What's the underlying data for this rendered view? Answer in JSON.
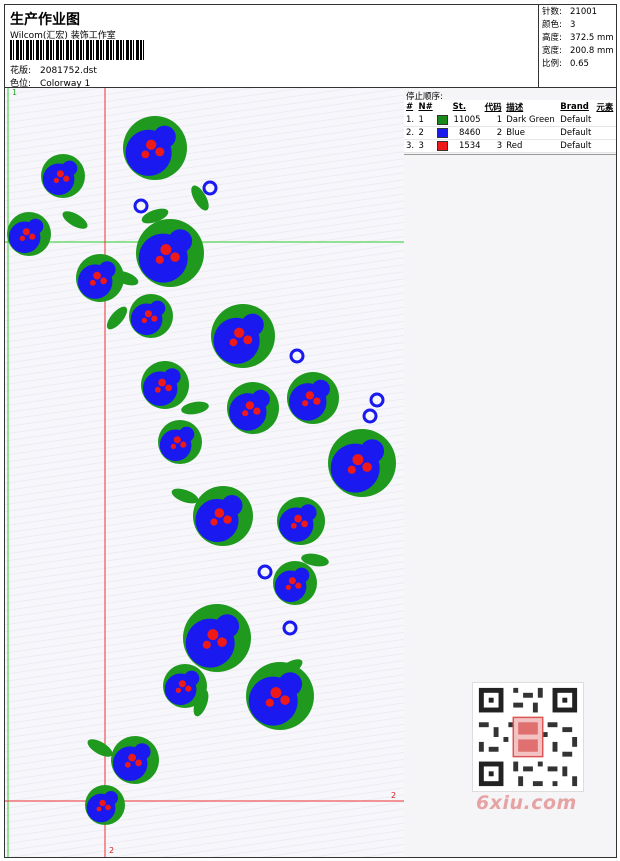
{
  "header": {
    "title": "生产作业图",
    "company": "Wilcom(汇宏) 装饰工作室",
    "file_label": "花版:",
    "file_value": "2081752.dst",
    "colorway_label": "色位:",
    "colorway_value": "Colorway 1"
  },
  "stats": [
    {
      "label": "针数:",
      "value": "21001"
    },
    {
      "label": "颜色:",
      "value": "3"
    },
    {
      "label": "高度:",
      "value": "372.5 mm"
    },
    {
      "label": "宽度:",
      "value": "200.8 mm"
    },
    {
      "label": "比例:",
      "value": "0.65"
    }
  ],
  "stop_sequence": {
    "title": "停止顺序:",
    "headers": [
      "#",
      "N#",
      "",
      "St.",
      "代码",
      "描述",
      "Brand",
      "元素"
    ],
    "rows": [
      {
        "n1": "1.",
        "n2": "1",
        "color": "#1a8a1a",
        "st": "11005",
        "code": "1",
        "desc": "Dark Green",
        "brand": "Default"
      },
      {
        "n1": "2.",
        "n2": "2",
        "color": "#1a1aee",
        "st": "8460",
        "code": "2",
        "desc": "Blue",
        "brand": "Default"
      },
      {
        "n1": "3.",
        "n2": "3",
        "color": "#ee1a1a",
        "st": "1534",
        "code": "3",
        "desc": "Red",
        "brand": "Default"
      }
    ]
  },
  "markers": {
    "m1": "1",
    "m2": "2",
    "m3": "2"
  },
  "watermark": "6xiu.com",
  "colors": {
    "green": "#1f9a1f",
    "blue": "#1a1af0",
    "red": "#ee1a1a"
  }
}
